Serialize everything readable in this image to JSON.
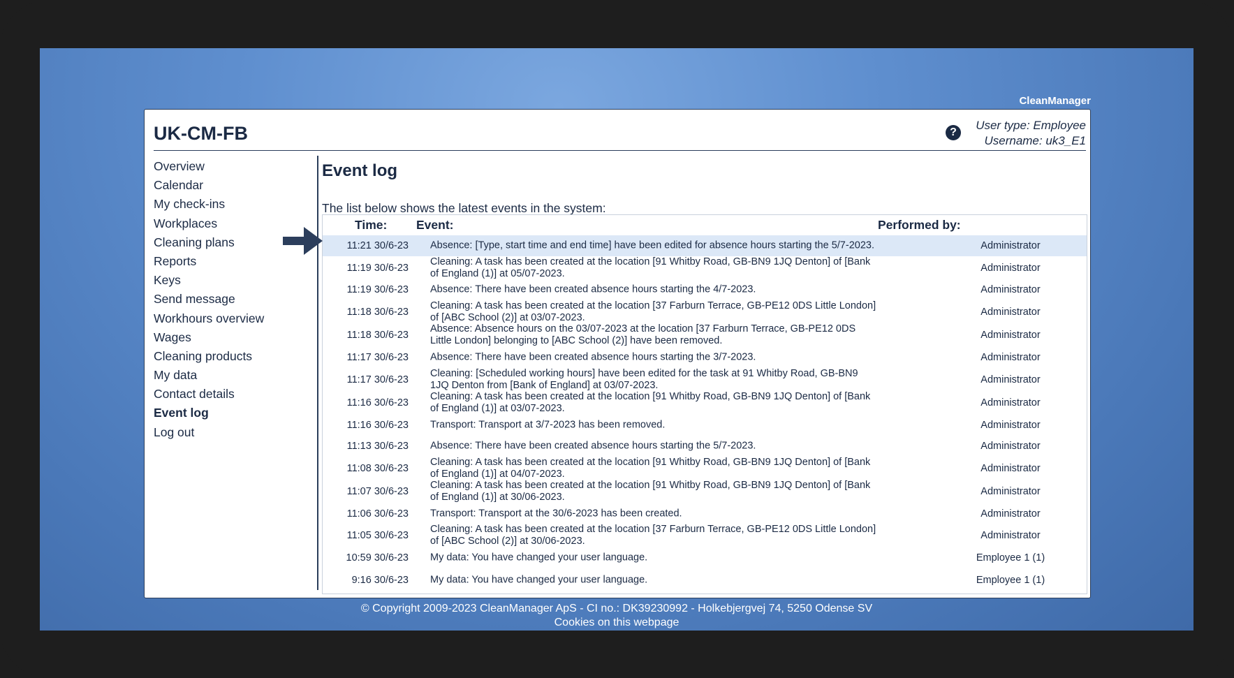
{
  "brand": "CleanManager",
  "site_title": "UK-CM-FB",
  "user": {
    "type_line": "User type: Employee",
    "username_line": "Username: uk3_E1",
    "help_icon": "help-circle-icon"
  },
  "nav": {
    "items": [
      {
        "label": "Overview"
      },
      {
        "label": "Calendar"
      },
      {
        "label": "My check-ins"
      },
      {
        "label": "Workplaces"
      },
      {
        "label": "Cleaning plans"
      },
      {
        "label": "Reports"
      },
      {
        "label": "Keys"
      },
      {
        "label": "Send message"
      },
      {
        "label": "Workhours overview"
      },
      {
        "label": "Wages"
      },
      {
        "label": "Cleaning products"
      },
      {
        "label": "My data"
      },
      {
        "label": "Contact details"
      },
      {
        "label": "Event log"
      },
      {
        "label": "Log out"
      }
    ],
    "active_index": 13
  },
  "page": {
    "title": "Event log",
    "intro": "The list below shows the latest events in the system:"
  },
  "table": {
    "headers": {
      "time": "Time:",
      "event": "Event:",
      "by": "Performed by:"
    },
    "rows": [
      {
        "time": "11:21 30/6-23",
        "event": "Absence: [Type, start time and end time] have been edited for absence hours starting the 5/7-2023.",
        "by": "Administrator"
      },
      {
        "time": "11:19 30/6-23",
        "event": "Cleaning: A task has been created at the location [91 Whitby Road, GB-BN9 1JQ Denton] of [Bank of England (1)] at 05/07-2023.",
        "by": "Administrator"
      },
      {
        "time": "11:19 30/6-23",
        "event": "Absence: There have been created absence hours starting the 4/7-2023.",
        "by": "Administrator"
      },
      {
        "time": "11:18 30/6-23",
        "event": "Cleaning: A task has been created at the location [37 Farburn Terrace, GB-PE12 0DS Little London] of [ABC School (2)] at 03/07-2023.",
        "by": "Administrator"
      },
      {
        "time": "11:18 30/6-23",
        "event": "Absence: Absence hours on the 03/07-2023 at the location [37 Farburn Terrace, GB-PE12 0DS Little London] belonging to [ABC School (2)] have been removed.",
        "by": "Administrator"
      },
      {
        "time": "11:17 30/6-23",
        "event": "Absence: There have been created absence hours starting the 3/7-2023.",
        "by": "Administrator"
      },
      {
        "time": "11:17 30/6-23",
        "event": "Cleaning: [Scheduled working hours] have been edited for the task at 91 Whitby Road, GB-BN9 1JQ Denton from [Bank of England] at 03/07-2023.",
        "by": "Administrator"
      },
      {
        "time": "11:16 30/6-23",
        "event": "Cleaning: A task has been created at the location [91 Whitby Road, GB-BN9 1JQ Denton] of [Bank of England (1)] at 03/07-2023.",
        "by": "Administrator"
      },
      {
        "time": "11:16 30/6-23",
        "event": "Transport: Transport at 3/7-2023 has been removed.",
        "by": "Administrator"
      },
      {
        "time": "11:13 30/6-23",
        "event": "Absence: There have been created absence hours starting the 5/7-2023.",
        "by": "Administrator"
      },
      {
        "time": "11:08 30/6-23",
        "event": "Cleaning: A task has been created at the location [91 Whitby Road, GB-BN9 1JQ Denton] of [Bank of England (1)] at 04/07-2023.",
        "by": "Administrator"
      },
      {
        "time": "11:07 30/6-23",
        "event": "Cleaning: A task has been created at the location [91 Whitby Road, GB-BN9 1JQ Denton] of [Bank of England (1)] at 30/06-2023.",
        "by": "Administrator"
      },
      {
        "time": "11:06 30/6-23",
        "event": "Transport: Transport at the 30/6-2023 has been created.",
        "by": "Administrator"
      },
      {
        "time": "11:05 30/6-23",
        "event": "Cleaning: A task has been created at the location [37 Farburn Terrace, GB-PE12 0DS Little London] of [ABC School (2)] at 30/06-2023.",
        "by": "Administrator"
      },
      {
        "time": "10:59 30/6-23",
        "event": "My data: You have changed your user language.",
        "by": "Employee 1 (1)"
      },
      {
        "time": "9:16 30/6-23",
        "event": "My data: You have changed your user language.",
        "by": "Employee 1 (1)"
      }
    ]
  },
  "footer": {
    "copyright": "© Copyright 2009-2023 CleanManager ApS - CI no.: DK39230992 - Holkebjergvej 74, 5250 Odense SV",
    "cookies": "Cookies on this webpage"
  },
  "annotation": {
    "arrow_icon": "right-arrow-icon",
    "color": "#2c3e5c"
  },
  "colors": {
    "accent": "#1b2a44",
    "highlight": "#dce8f7"
  }
}
